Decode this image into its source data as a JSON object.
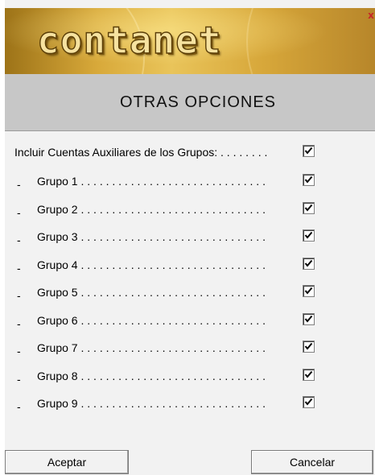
{
  "app": {
    "logo_text": "contanet",
    "close_glyph": "x"
  },
  "dialog": {
    "title": "OTRAS OPCIONES"
  },
  "main_option": {
    "label": "Incluir Cuentas Auxiliares de los Grupos: . . . . . . . .",
    "checked": true
  },
  "groups": [
    {
      "label": "Grupo 1 . . . . . . . . . . . . . . . . . . . . . . . . . . . . . .",
      "checked": true
    },
    {
      "label": "Grupo 2 . . . . . . . . . . . . . . . . . . . . . . . . . . . . . .",
      "checked": true
    },
    {
      "label": "Grupo 3 . . . . . . . . . . . . . . . . . . . . . . . . . . . . . .",
      "checked": true
    },
    {
      "label": "Grupo 4 . . . . . . . . . . . . . . . . . . . . . . . . . . . . . .",
      "checked": true
    },
    {
      "label": "Grupo 5 . . . . . . . . . . . . . . . . . . . . . . . . . . . . . .",
      "checked": true
    },
    {
      "label": "Grupo 6 . . . . . . . . . . . . . . . . . . . . . . . . . . . . . .",
      "checked": true
    },
    {
      "label": "Grupo 7 . . . . . . . . . . . . . . . . . . . . . . . . . . . . . .",
      "checked": true
    },
    {
      "label": "Grupo 8 . . . . . . . . . . . . . . . . . . . . . . . . . . . . . .",
      "checked": true
    },
    {
      "label": "Grupo 9 . . . . . . . . . . . . . . . . . . . . . . . . . . . . . .",
      "checked": true
    }
  ],
  "buttons": {
    "accept": "Aceptar",
    "cancel": "Cancelar"
  },
  "colors": {
    "banner_gold": "#d8a93a",
    "title_bar": "#c7c7c7",
    "dialog_bg": "#f2f2f2",
    "close_red": "#c62828"
  }
}
